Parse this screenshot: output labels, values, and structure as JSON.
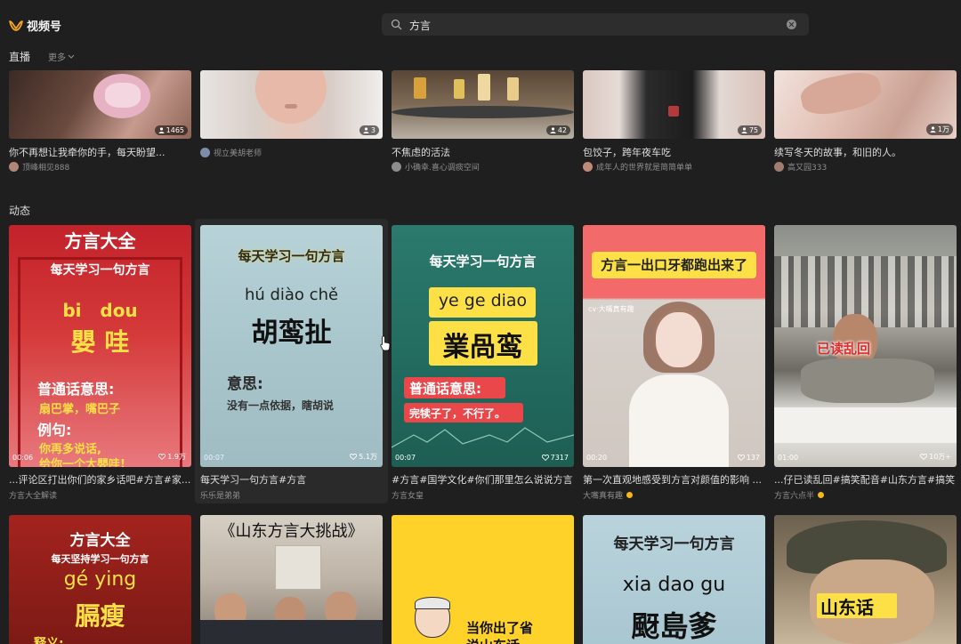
{
  "app": {
    "title": "视频号"
  },
  "search": {
    "query": "方言"
  },
  "live_section": {
    "label": "直播",
    "more_label": "更多",
    "cards": [
      {
        "title": "你不再想让我牵你的手，每天盼望...",
        "author": "顶峰相见888",
        "viewers": "1465"
      },
      {
        "title": "",
        "author": "视立美胡老师",
        "viewers": "3"
      },
      {
        "title": "不焦虑的活法",
        "author": "小确幸.喜心调痰空间",
        "viewers": "42"
      },
      {
        "title": "包饺子，跨年夜车吃",
        "author": "成年人的世界就是简简单单",
        "viewers": "75"
      },
      {
        "title": "续写冬天的故事，和旧的人。",
        "author": "高又园333",
        "viewers": "1万"
      }
    ]
  },
  "feed_section": {
    "label": "动态",
    "cards": [
      {
        "title": "...评论区打出你们的家乡话吧#方言#家...",
        "author": "方言大全解读",
        "duration": "00:06",
        "likes": "1.9万",
        "verified": false,
        "overlay": {
          "top": "方言大全",
          "line1": "每天学习一句方言",
          "pinyin_a": "bi",
          "pinyin_b": "dou",
          "chars": "嬰 哇",
          "meaning_label": "普通话意思:",
          "meaning": "扇巴掌，嘴巴子",
          "example_label": "例句:",
          "example_1": "你再多说话,",
          "example_2": "给你一个大嬰哇!"
        }
      },
      {
        "title": "每天学习一句方言#方言",
        "author": "乐乐是弟弟",
        "duration": "00:07",
        "likes": "5.1万",
        "verified": false,
        "overlay": {
          "line1": "每天学习一句方言",
          "pinyin": "hú diào chě",
          "chars": "胡鸾扯",
          "meaning_label": "意思:",
          "meaning": "没有一点依据，瞎胡说"
        }
      },
      {
        "title": "#方言#国学文化#你们那里怎么说说方言",
        "author": "方言女皇",
        "duration": "00:07",
        "likes": "7317",
        "verified": false,
        "overlay": {
          "line1": "每天学习一句方言",
          "pinyin": "ye ge diao",
          "chars": "業咼鸾",
          "meaning_label": "普通话意思:",
          "meaning": "完犊子了，不行了。"
        }
      },
      {
        "title": "第一次直观地感受到方言对颜值的影响 ...",
        "author": "大嘴真有趣",
        "duration": "00:20",
        "likes": "137",
        "verified": true,
        "overlay": {
          "banner": "方言一出口牙都跑出来了",
          "watermark": "cv·大嘴真有趣"
        }
      },
      {
        "title": "...仔已读乱回#搞笑配音#山东方言#搞笑",
        "author": "方言六点半",
        "duration": "01:00",
        "likes": "10万+",
        "verified": true,
        "overlay": {
          "caption": "已读乱回"
        }
      }
    ],
    "row2": [
      {
        "top": "方言大全",
        "line1": "每天坚持学习一句方言",
        "pinyin": "gé ying",
        "chars": "膈瘦",
        "label": "释义:"
      },
      {
        "top": "《山东方言大挑战》"
      },
      {
        "text_1": "当你出了省",
        "text_2": "说山东话"
      },
      {
        "line1": "每天学习一句方言",
        "pinyin": "xia dao gu",
        "chars": "颬島爹"
      },
      {
        "caption": "山东话"
      }
    ]
  }
}
